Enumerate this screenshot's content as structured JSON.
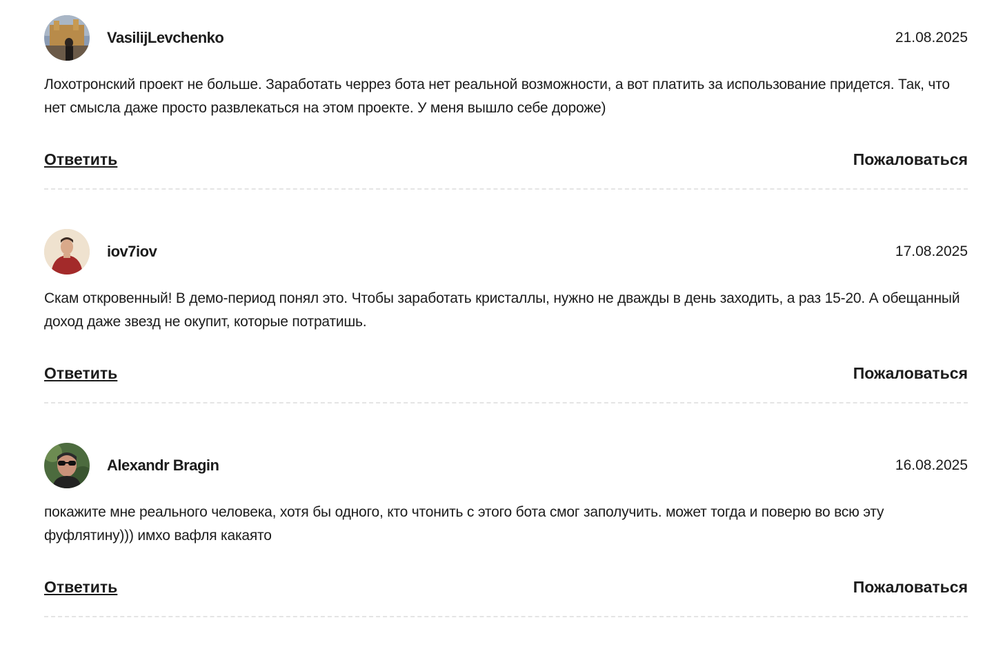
{
  "comments": [
    {
      "author": "VasilijLevchenko",
      "date": "21.08.2025",
      "text": "Лохотронский проект не больше. Заработать черрез бота нет реальной возможности, а вот платить за использование придется. Так, что нет смысла даже просто развлекаться на этом проекте. У меня вышло себе дороже)",
      "reply_label": "Ответить",
      "report_label": "Пожаловаться"
    },
    {
      "author": "iov7iov",
      "date": "17.08.2025",
      "text": "Скам откровенный! В демо-период понял это. Чтобы заработать кристаллы, нужно не дважды в день заходить, а раз 15-20. А обещанный доход даже звезд не окупит, которые потратишь.",
      "reply_label": "Ответить",
      "report_label": "Пожаловаться"
    },
    {
      "author": "Alexandr Bragin",
      "date": "16.08.2025",
      "text": "покажите мне реального человека, хотя бы одного, кто чтонить с этого бота смог заполучить. может тогда и поверю во всю эту фуфлятину))) имхо вафля какаято",
      "reply_label": "Ответить",
      "report_label": "Пожаловаться"
    }
  ]
}
